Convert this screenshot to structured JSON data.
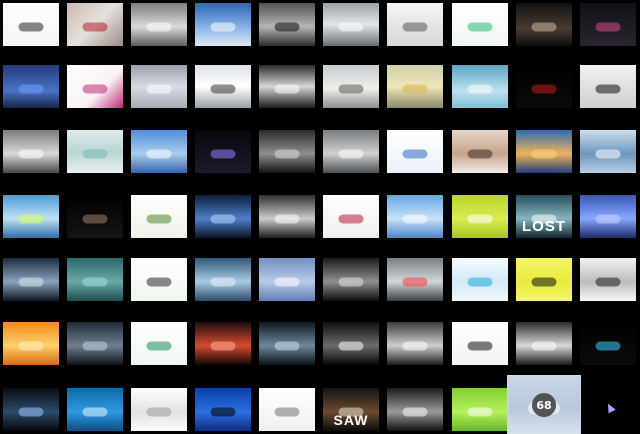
{
  "grid": {
    "rows": [
      [
        {
          "name": "thumb-silhouettes",
          "bg": "linear-gradient(#ffffff,#f4f4f4)",
          "accent": "#222222"
        },
        {
          "name": "thumb-red-figure",
          "bg": "linear-gradient(135deg,#cbb9b0,#e6e1dc 50%,#9a8c86)",
          "accent": "#b3202a"
        },
        {
          "name": "thumb-gray-landscape",
          "bg": "linear-gradient(#7d7d7d,#dadada 55%,#5c5c5c)",
          "accent": "#ffffff"
        },
        {
          "name": "thumb-blue-sky-clouds",
          "bg": "linear-gradient(#2b65b8,#8fb8e8 60%,#dfe9f3)",
          "accent": "#ffffff"
        },
        {
          "name": "thumb-black-car",
          "bg": "linear-gradient(#515151,#b6b6b6 55%,#2b2b2b)",
          "accent": "#111111"
        },
        {
          "name": "thumb-silver-car",
          "bg": "linear-gradient(#9ea3a8,#e2e5e8 50%,#6a6e72)",
          "accent": "#ffffff"
        },
        {
          "name": "thumb-car-sketch",
          "bg": "linear-gradient(#f6f6f6,#d6d6d6)",
          "accent": "#555555"
        },
        {
          "name": "thumb-green-swirl",
          "bg": "linear-gradient(#ffffff,#f2f7f3)",
          "accent": "#2bb673"
        },
        {
          "name": "thumb-woman-dark",
          "bg": "linear-gradient(#121212,#4a3c33 60%,#0d0d0d)",
          "accent": "#d0b49a"
        },
        {
          "name": "thumb-dark-figure",
          "bg": "linear-gradient(#101018,#2a2530)",
          "accent": "#d64a8c"
        }
      ],
      [
        {
          "name": "thumb-blue-texture",
          "bg": "linear-gradient(#243a80,#4a74c4 60%,#16244d)",
          "accent": "#6f9bff"
        },
        {
          "name": "thumb-pink-floral",
          "bg": "linear-gradient(135deg,#ffffff,#f8f2f6 60%,#c02a74)",
          "accent": "#c02a74"
        },
        {
          "name": "thumb-gray-gradient",
          "bg": "linear-gradient(#9aa1ab,#d8dde4 50%,#a6acb5)",
          "accent": "#ffffff"
        },
        {
          "name": "thumb-white-car",
          "bg": "linear-gradient(#dfe3e6,#ffffff 50%,#9aa0a5)",
          "accent": "#333333"
        },
        {
          "name": "thumb-bw-abstract",
          "bg": "linear-gradient(#2c2c2c,#d6d6d6 50%,#1c1c1c)",
          "accent": "#ffffff"
        },
        {
          "name": "thumb-car-beach",
          "bg": "linear-gradient(#c6cdd2,#f1efe8 55%,#8e8f8e)",
          "accent": "#5a5a5a"
        },
        {
          "name": "thumb-blonde-woman",
          "bg": "linear-gradient(#cfcfa8,#f0e6b8 50%,#8a8a6e)",
          "accent": "#d7b24a"
        },
        {
          "name": "thumb-teal-logo",
          "bg": "linear-gradient(#5aa6c6,#bfe1ee 60%,#7fc0d7)",
          "accent": "#ffffff"
        },
        {
          "name": "thumb-red-lips-dark",
          "bg": "linear-gradient(#000000,#0a0a0a)",
          "accent": "#c21a1a"
        },
        {
          "name": "thumb-hair-swirl",
          "bg": "linear-gradient(#f2f2f2,#cfcfcf)",
          "accent": "#111111"
        }
      ],
      [
        {
          "name": "thumb-silver-convertible",
          "bg": "linear-gradient(#7b7b7b,#d9d9d9 55%,#474747)",
          "accent": "#ffffff"
        },
        {
          "name": "thumb-teal-frame",
          "bg": "linear-gradient(#dfe9e9,#b9d7d6 50%,#e8eeee)",
          "accent": "#6fb6b3"
        },
        {
          "name": "thumb-blue-water",
          "bg": "linear-gradient(#4e8fd8,#a9cdef 55%,#3466a8)",
          "accent": "#ffffff"
        },
        {
          "name": "thumb-purple-ribbon",
          "bg": "linear-gradient(#07070c,#1d1a2c)",
          "accent": "#9a7bff"
        },
        {
          "name": "thumb-dark-car-road",
          "bg": "linear-gradient(#2a2a2a,#8f8f8f 55%,#111111)",
          "accent": "#dddddd"
        },
        {
          "name": "thumb-car-gray",
          "bg": "linear-gradient(#7b7e80,#cfd1d2 55%,#4c4f52)",
          "accent": "#ffffff"
        },
        {
          "name": "thumb-blue-swirl",
          "bg": "linear-gradient(#ffffff,#eaf2fb)",
          "accent": "#2e6ac4"
        },
        {
          "name": "thumb-woman-portrait",
          "bg": "linear-gradient(#e6d6c8,#c8a48a 55%,#f2ece7)",
          "accent": "#3a2a22"
        },
        {
          "name": "thumb-sunset-sea",
          "bg": "linear-gradient(#2b6cb0,#f0b35b 55%,#1e3f7a)",
          "accent": "#ffd27a"
        },
        {
          "name": "thumb-blue-wave",
          "bg": "linear-gradient(#cfe0ee,#6d96bd 55%,#b9cfe2)",
          "accent": "#ffffff"
        }
      ],
      [
        {
          "name": "thumb-blue-figure",
          "bg": "linear-gradient(#4a9ad8,#bfe2f4 55%,#2f6fa8)",
          "accent": "#d9ff5a"
        },
        {
          "name": "thumb-dark-face",
          "bg": "linear-gradient(#000000,#151515)",
          "accent": "#a07f68"
        },
        {
          "name": "thumb-green-vines",
          "bg": "linear-gradient(#ffffff,#eef3e8)",
          "accent": "#4c8a2a"
        },
        {
          "name": "thumb-blue-abstract",
          "bg": "linear-gradient(#0c1e3b,#4f7ec9 55%,#091427)",
          "accent": "#b9d7ff"
        },
        {
          "name": "thumb-gray-car",
          "bg": "linear-gradient(#2f2f2f,#cccccc 55%,#1e1e1e)",
          "accent": "#ffffff"
        },
        {
          "name": "thumb-red-floral",
          "bg": "linear-gradient(#ffffff,#f2eef0)",
          "accent": "#b8193a"
        },
        {
          "name": "thumb-blue-paint",
          "bg": "linear-gradient(#63a6e6,#c9e2f7 55%,#4b86c9)",
          "accent": "#ffffff"
        },
        {
          "name": "thumb-lime-green",
          "bg": "linear-gradient(#b9d22a,#d9ec52 55%,#a9c41f)",
          "accent": "#ffffff"
        },
        {
          "name": "thumb-lost-title",
          "bg": "linear-gradient(#274f5d,#86b4bf 55%,#10262e)",
          "accent": "#ffffff",
          "caption": "LOST",
          "captionSize": "15px"
        },
        {
          "name": "thumb-blue-figure-light",
          "bg": "linear-gradient(#3756b8,#8aa8ff 55%,#1a2a66)",
          "accent": "#cbd6ff"
        }
      ],
      [
        {
          "name": "thumb-blue-concept-car",
          "bg": "linear-gradient(#1c2c3e,#8aa2bd 55%,#0e1620)",
          "accent": "#dfe7ef"
        },
        {
          "name": "thumb-teal-pattern",
          "bg": "linear-gradient(#2b6a6b,#6aa9a7 55%,#1c4c4d)",
          "accent": "#a8dcd9"
        },
        {
          "name": "thumb-green-skater",
          "bg": "linear-gradient(#ffffff,#f1f6ef)",
          "accent": "#2a2a2a"
        },
        {
          "name": "thumb-blue-rays",
          "bg": "linear-gradient(#2d5a7a,#a9cbe4 55%,#264c68)",
          "accent": "#e7f3ff"
        },
        {
          "name": "thumb-cube-wireframe",
          "bg": "linear-gradient(#6f8fc2,#b9cbe8 55%,#5f7fb3)",
          "accent": "#ffffff"
        },
        {
          "name": "thumb-woman-bw",
          "bg": "linear-gradient(#1b1b1b,#8f8f8f 55%,#0c0c0c)",
          "accent": "#e5e5e5"
        },
        {
          "name": "thumb-car-street",
          "bg": "linear-gradient(#7b7f86,#d1d6dc 55%,#3c4045)",
          "accent": "#ff3b3b"
        },
        {
          "name": "thumb-gear-cyan",
          "bg": "linear-gradient(#f6fbff,#d2eaf7 55%,#f2f7fb)",
          "accent": "#21a7d8"
        },
        {
          "name": "thumb-yellow-face",
          "bg": "linear-gradient(#f1f36a,#e8ec3a 55%,#f4f56d)",
          "accent": "#111111"
        },
        {
          "name": "thumb-gray-swirl",
          "bg": "linear-gradient(#f2f2f2,#bdbdbd 55%,#f7f7f7)",
          "accent": "#1b1b1b"
        }
      ],
      [
        {
          "name": "thumb-orange-glow",
          "bg": "linear-gradient(#f08a1b,#ffd16a 55%,#d86a10)",
          "accent": "#fff1c4"
        },
        {
          "name": "thumb-dark-flower",
          "bg": "linear-gradient(#1f2a37,#6f7f90 55%,#0d1218)",
          "accent": "#c6d1dc"
        },
        {
          "name": "thumb-green-leaf",
          "bg": "linear-gradient(#ffffff,#eef8f2)",
          "accent": "#1d8b5a"
        },
        {
          "name": "thumb-red-burst",
          "bg": "linear-gradient(#1c0d0d,#d84b2f 55%,#0d0505)",
          "accent": "#ffb199"
        },
        {
          "name": "thumb-dark-car-front",
          "bg": "linear-gradient(#0e1922,#6e8799 55%,#09131a)",
          "accent": "#cfe1ee"
        },
        {
          "name": "thumb-black-sedan",
          "bg": "linear-gradient(#101010,#6b6b6b 55%,#050505)",
          "accent": "#ffffff"
        },
        {
          "name": "thumb-mercedes-logo",
          "bg": "linear-gradient(#3c3c3c,#cfcfcf 55%,#1c1c1c)",
          "accent": "#ffffff"
        },
        {
          "name": "thumb-white-splash",
          "bg": "linear-gradient(#ffffff,#f3f3f3)",
          "accent": "#111111"
        },
        {
          "name": "thumb-silver-car-side",
          "bg": "linear-gradient(#2b2b2b,#d8d8d8 55%,#1a1a1a)",
          "accent": "#ffffff"
        },
        {
          "name": "thumb-neon-swirl",
          "bg": "linear-gradient(#000000,#0b0b0b)",
          "accent": "#37d2ff"
        }
      ],
      [
        {
          "name": "thumb-dark-sports-car",
          "bg": "linear-gradient(#070b12,#2d4b6a 55%,#04070c)",
          "accent": "#9cc7ff"
        },
        {
          "name": "thumb-blue-apple",
          "bg": "linear-gradient(#0b6aa8,#2f9ae0 55%,#0a4f80)",
          "accent": "#e6f5ff"
        },
        {
          "name": "thumb-silver-sphere",
          "bg": "linear-gradient(#ffffff,#e2e2e2 55%,#fbfbfb)",
          "accent": "#9a9a9a"
        },
        {
          "name": "thumb-blue-crouching",
          "bg": "linear-gradient(#0c3fa8,#2c6fe0 55%,#0a2f82)",
          "accent": "#000000"
        },
        {
          "name": "thumb-white-sketch",
          "bg": "linear-gradient(#ffffff,#f1f1f1)",
          "accent": "#777777"
        },
        {
          "name": "thumb-saw-poster",
          "bg": "linear-gradient(#141414,#6b4a2e 55%,#0b0b0b)",
          "accent": "#e9e1d6",
          "caption": "SAW",
          "captionSize": "14px"
        },
        {
          "name": "thumb-black-silhouette",
          "bg": "linear-gradient(#1a1a1a,#9a9a9a 55%,#101010)",
          "accent": "#ffffff"
        },
        {
          "name": "thumb-green-gradient",
          "bg": "linear-gradient(#7fd12f,#b7ef5e 55%,#66b820)",
          "accent": "#ffffff"
        },
        {
          "name": "thumb-white-leaves",
          "bg": "linear-gradient(#ffffff,#f6f0ea)",
          "accent": "#8a5a3a"
        },
        {
          "name": "thumb-selected-car",
          "bg": "linear-gradient(#c9d6e6,#b8c8dc 55%,#d7e1ed)",
          "accent": "#ffffff",
          "selected": true,
          "badge": "68"
        },
        {
          "name": "thumb-blank",
          "bg": "linear-gradient(#000000,#000000)",
          "accent": "#000000"
        }
      ]
    ]
  }
}
